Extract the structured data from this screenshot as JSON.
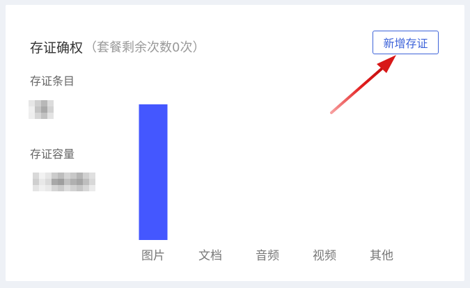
{
  "panel": {
    "title": "存证确权",
    "quota_text": "（套餐剩余次数0次）",
    "add_button_label": "新增存证"
  },
  "stats": [
    {
      "label": "存证条目"
    },
    {
      "label": "存证容量"
    }
  ],
  "colors": {
    "bar": "#4457ff",
    "accent": "#3d63d9",
    "arrow": "#e31e1e"
  },
  "chart_data": {
    "type": "bar",
    "categories": [
      "图片",
      "文档",
      "音频",
      "视频",
      "其他"
    ],
    "values": [
      1,
      0,
      0,
      0,
      0
    ],
    "ylim": [
      0,
      1
    ],
    "grid": false,
    "title": "",
    "xlabel": "",
    "ylabel": ""
  }
}
